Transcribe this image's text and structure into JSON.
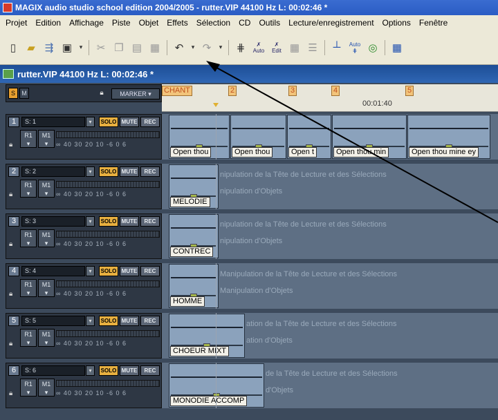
{
  "window": {
    "title": "MAGIX audio studio school edition 2004/2005 - rutter.VIP    44100 Hz L: 00:02:46 *"
  },
  "menu": [
    "Projet",
    "Edition",
    "Affichage",
    "Piste",
    "Objet",
    "Effets",
    "Sélection",
    "CD",
    "Outils",
    "Lecture/enregistrement",
    "Options",
    "Fenêtre"
  ],
  "toolbar_icons": [
    "new-file-icon",
    "open-folder-icon",
    "import-icon",
    "save-icon",
    "dropdown-icon",
    "cut-icon",
    "copy-icon",
    "paste-icon",
    "delete-icon",
    "undo-icon",
    "undo-dropdown-icon",
    "redo-icon",
    "redo-dropdown-icon",
    "snap-icon",
    "auto-cut-icon",
    "edit-cut-icon",
    "grid-icon",
    "mixer-icon",
    "marker-add-icon",
    "auto-marker-icon",
    "cd-icon",
    "extra-icon"
  ],
  "toolbar_text": {
    "auto": "Auto",
    "edit": "Edit",
    "auto2": "Auto"
  },
  "project": {
    "title": "rutter.VIP   44100 Hz L: 00:02:46 *"
  },
  "header": {
    "s_label": "S",
    "m_label": "M",
    "marker_label": "MARKER"
  },
  "ruler": {
    "markers": [
      "CHANT",
      "2",
      "3",
      "4",
      "5"
    ],
    "time": "00:01:40"
  },
  "tracks": [
    {
      "num": "1",
      "name": "S: 1",
      "solo": "SOLO",
      "mute": "MUTE",
      "rec": "REC",
      "r1": "R1",
      "m1": "M1",
      "scale": "∞ 40 30 20 10 -6 0 6",
      "clips": [
        "Open thou",
        "Open thou",
        "Open t",
        "Open thou min",
        "Open thou mine ey"
      ],
      "hints": []
    },
    {
      "num": "2",
      "name": "S: 2",
      "solo": "SOLO",
      "mute": "MUTE",
      "rec": "REC",
      "r1": "R1",
      "m1": "M1",
      "scale": "∞ 40 30 20 10 -6 0 6",
      "clips": [
        "MELODIE"
      ],
      "hints": [
        "nipulation de la Tête de Lecture et des Sélections",
        "nipulation d'Objets"
      ]
    },
    {
      "num": "3",
      "name": "S: 3",
      "solo": "SOLO",
      "mute": "MUTE",
      "rec": "REC",
      "r1": "R1",
      "m1": "M1",
      "scale": "∞ 40 30 20 10 -6 0 6",
      "clips": [
        "CONTREC"
      ],
      "hints": [
        "nipulation de la Tête de Lecture et des Sélections",
        "nipulation d'Objets"
      ]
    },
    {
      "num": "4",
      "name": "S: 4",
      "solo": "SOLO",
      "mute": "MUTE",
      "rec": "REC",
      "r1": "R1",
      "m1": "M1",
      "scale": "∞ 40 30 20 10 -6 0 6",
      "clips": [
        "HOMME"
      ],
      "hints": [
        "Manipulation de la Tête de Lecture et des Sélections",
        "Manipulation d'Objets"
      ]
    },
    {
      "num": "5",
      "name": "S: 5",
      "solo": "SOLO",
      "mute": "MUTE",
      "rec": "REC",
      "r1": "R1",
      "m1": "M1",
      "scale": "∞ 40 30 20 10 -6 0 6",
      "clips": [
        "CHOEUR MIXT"
      ],
      "hints": [
        "ation de la Tête de Lecture et des Sélections",
        "ation d'Objets"
      ]
    },
    {
      "num": "6",
      "name": "S: 6",
      "solo": "SOLO",
      "mute": "MUTE",
      "rec": "REC",
      "r1": "R1",
      "m1": "M1",
      "scale": "∞ 40 30 20 10 -6 0 6",
      "clips": [
        "MONODIE ACCOMP"
      ],
      "hints": [
        "de la Tête de Lecture et des Sélections",
        "d'Objets"
      ]
    }
  ],
  "colors": {
    "title_bar": "#2a5cc4",
    "project_bar": "#1d4e96",
    "workspace": "#3c4a5c",
    "clip": "#8ba2bc",
    "solo": "#e8b040",
    "marker": "#f2c47a"
  }
}
